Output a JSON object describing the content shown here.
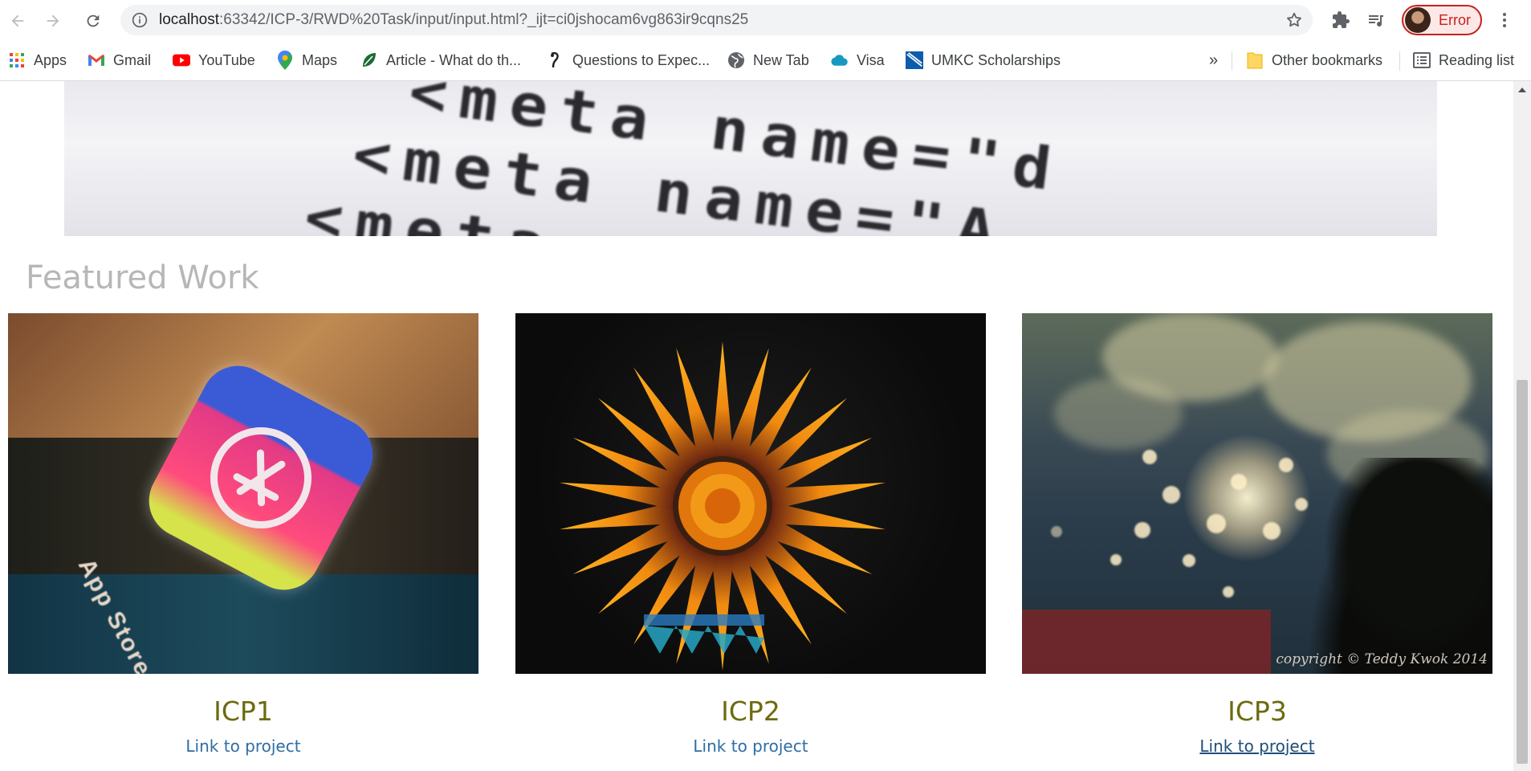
{
  "browser": {
    "url_host": "localhost",
    "url_rest": ":63342/ICP-3/RWD%20Task/input/input.html?_ijt=ci0jshocam6vg863ir9cqns25",
    "profile_label": "Error"
  },
  "bookmarks": {
    "items": [
      {
        "label": "Apps",
        "icon": "apps-grid-icon"
      },
      {
        "label": "Gmail",
        "icon": "gmail-icon"
      },
      {
        "label": "YouTube",
        "icon": "youtube-icon"
      },
      {
        "label": "Maps",
        "icon": "maps-icon"
      },
      {
        "label": "Article - What do th...",
        "icon": "article-leaf-icon"
      },
      {
        "label": "Questions to Expec...",
        "icon": "questions-icon"
      },
      {
        "label": "New Tab",
        "icon": "globe-icon"
      },
      {
        "label": "Visa",
        "icon": "cloud-icon"
      },
      {
        "label": "UMKC Scholarships",
        "icon": "umkc-icon"
      }
    ],
    "overflow": "»",
    "other": "Other bookmarks",
    "reading_list": "Reading list"
  },
  "page": {
    "hero_lines": [
      "<meta   name=\"d",
      "<meta   name=\"A",
      "<meta   name=\"d"
    ],
    "section_title": "Featured Work",
    "cards": [
      {
        "title": "ICP1",
        "link": "Link to project",
        "image_text": "App Store"
      },
      {
        "title": "ICP2",
        "link": "Link to project"
      },
      {
        "title": "ICP3",
        "link": "Link to project",
        "image_text": "copyright © Teddy Kwok 2014"
      }
    ]
  }
}
